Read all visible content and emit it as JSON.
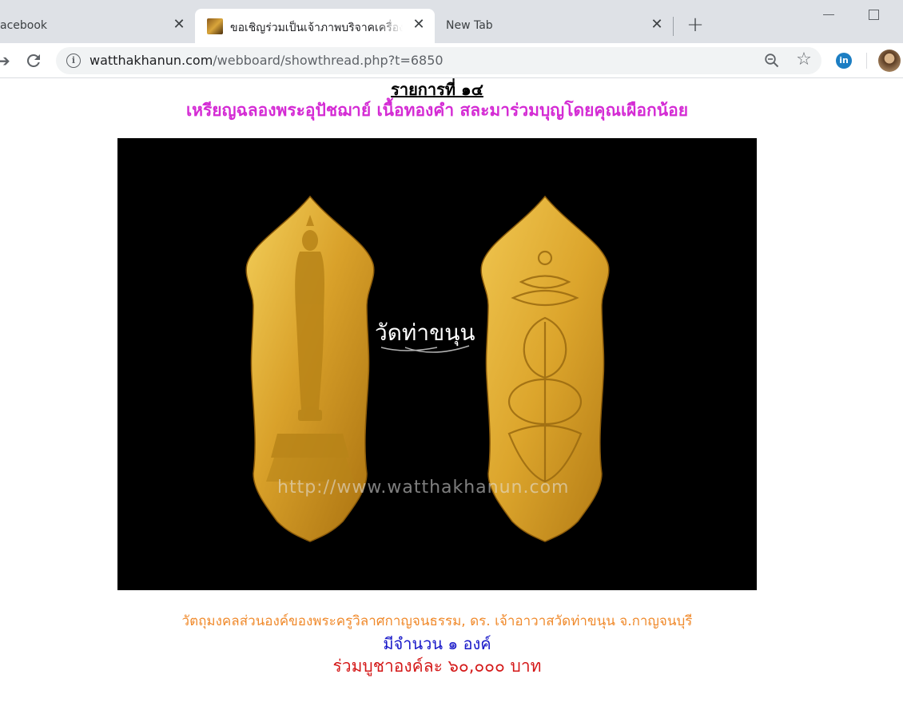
{
  "browser": {
    "tabs": [
      {
        "title": "acebook",
        "close": "✕"
      },
      {
        "title": "ขอเชิญร่วมเป็นเจ้าภาพบริจาคเครื่องฟอ",
        "close": "✕"
      },
      {
        "title": "New Tab",
        "close": "✕"
      }
    ],
    "new_tab": "+",
    "url_host": "watthakhanun.com",
    "url_path": "/webboard/showthread.php?t=6850",
    "extension_label": "in"
  },
  "page": {
    "item_heading": "รายการที่ ๑๔",
    "item_title": "เหรียญฉลองพระอุปัชฌาย์ เนื้อทองคำ สละมาร่วมบุญโดยคุณเผือกน้อย",
    "photo": {
      "watermark_label": "วัดท่าขนุน",
      "watermark_url": "http://www.watthakhanun.com"
    },
    "caption": "วัตถุมงคลส่วนองค์ของพระครูวิลาศกาญจนธรรม, ดร. เจ้าอาวาสวัดท่าขนุน จ.กาญจนบุรี",
    "quantity": "มีจำนวน ๑ องค์",
    "price": "ร่วมบูชาองค์ละ ๖๐,๐๐๐ บาท"
  },
  "colors": {
    "title_magenta": "#d42bd4",
    "caption_orange": "#f08a2c",
    "quantity_blue": "#1717c8",
    "price_red": "#d41818",
    "medal_gold": "#d9a12a"
  }
}
